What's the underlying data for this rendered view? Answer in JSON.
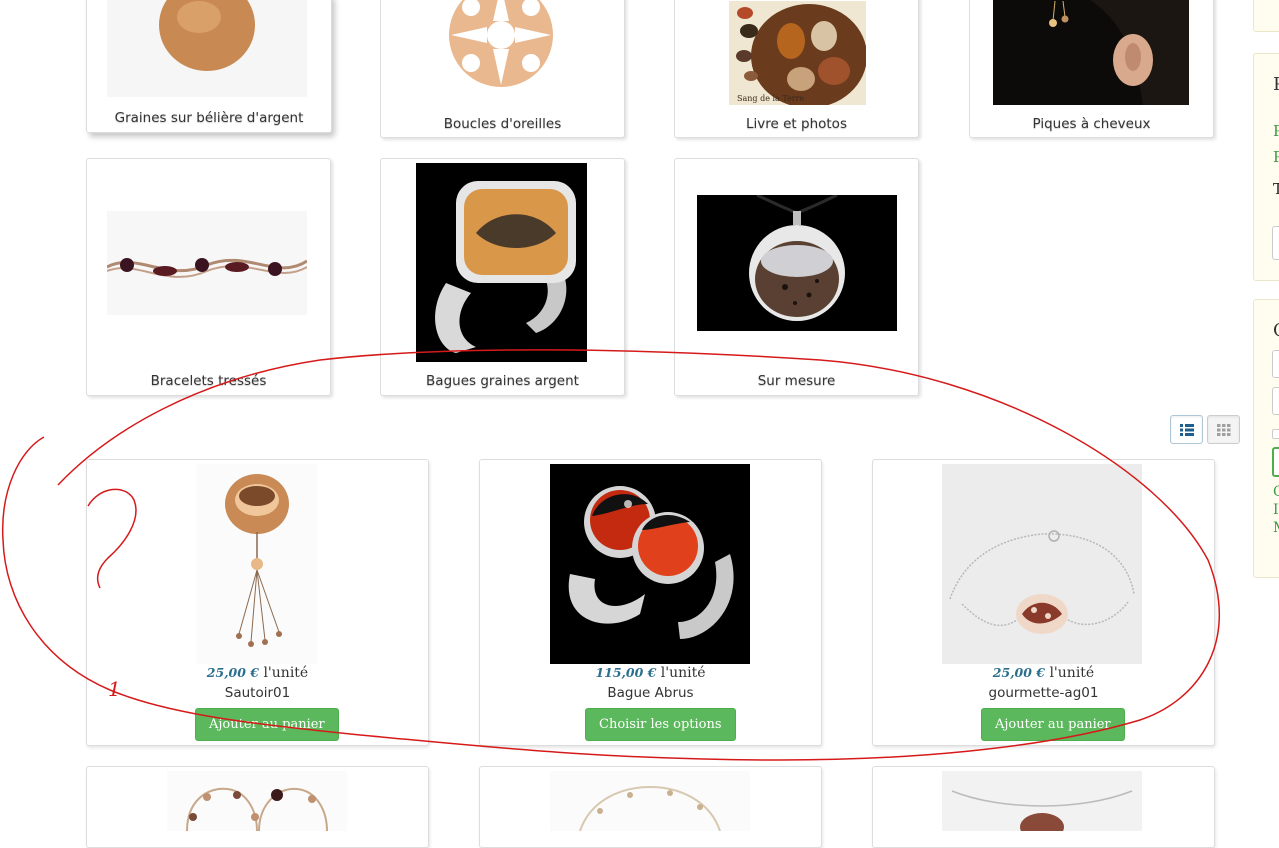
{
  "categories": [
    {
      "label": "Graines sur bélière d'argent"
    },
    {
      "label": "Boucles d'oreilles"
    },
    {
      "label": "Livre et photos"
    },
    {
      "label": "Piques à cheveux"
    },
    {
      "label": "Bracelets tressés"
    },
    {
      "label": "Bagues graines argent"
    },
    {
      "label": "Sur mesure"
    }
  ],
  "book_cover_text": "Sang de la Terre",
  "view_toggle": {
    "list_icon": "list-view-icon",
    "grid_icon": "grid-view-icon",
    "active": "list"
  },
  "products": [
    {
      "price": "25,00 €",
      "unit": "l'unité",
      "name": "Sautoir01",
      "button": "Ajouter au panier"
    },
    {
      "price": "115,00 €",
      "unit": "l'unité",
      "name": "Bague Abrus",
      "button": "Choisir les options"
    },
    {
      "price": "25,00 €",
      "unit": "l'unité",
      "name": "gourmette-ag01",
      "button": "Ajouter au panier"
    }
  ],
  "sidebar": {
    "panel1_initial": "P",
    "green_initials": [
      "P",
      "P"
    ],
    "dark_initial": "T",
    "panel2_initial": "C",
    "links": [
      "C",
      "I",
      "M"
    ]
  },
  "annotation": {
    "color": "#d61a1a",
    "mark": "1"
  },
  "colors": {
    "button_green": "#5cb85c",
    "price_blue": "#2b6f8f",
    "side_link_green": "#3c9a3c"
  }
}
